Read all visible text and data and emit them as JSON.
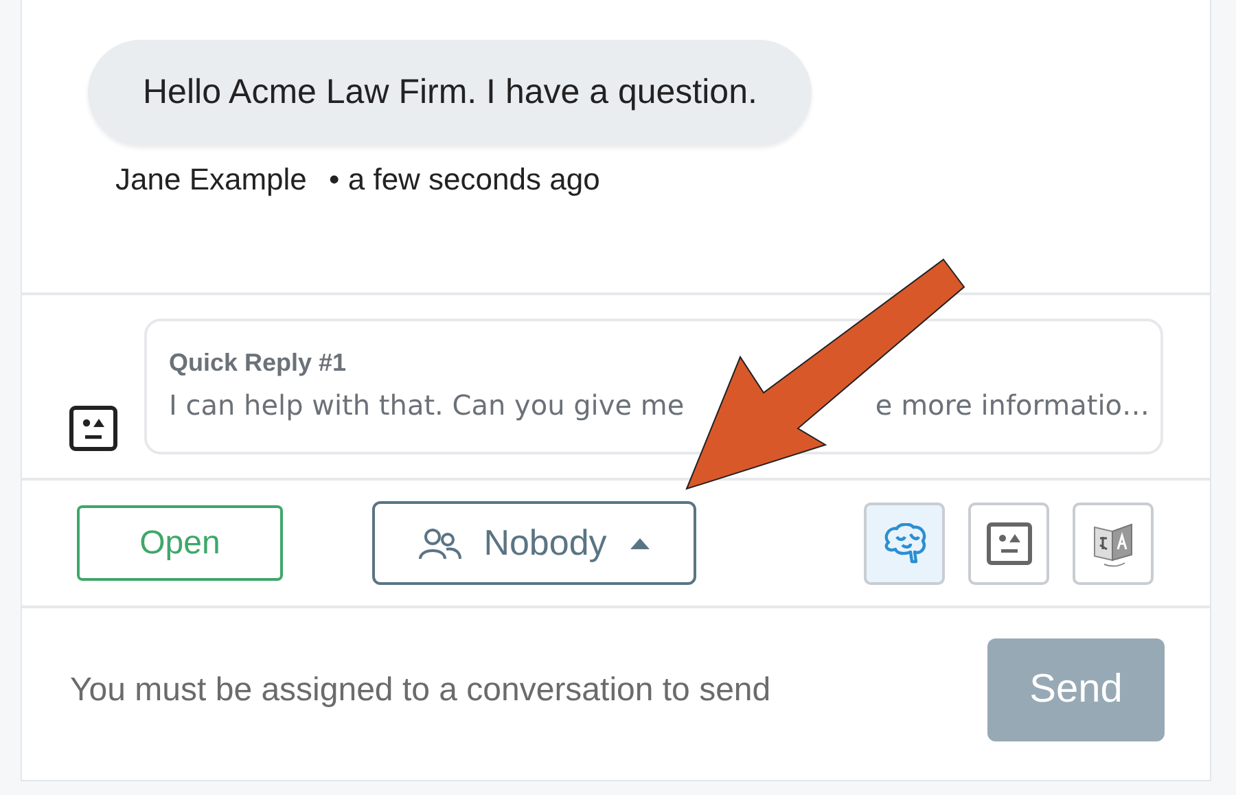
{
  "message": {
    "text": "Hello Acme Law Firm. I have a question.",
    "author": "Jane Example",
    "time": "• a few seconds ago"
  },
  "quick_reply": {
    "title": "Quick Reply #1",
    "text_parts": [
      "I can help with that. Can you give me",
      "e more informatio…"
    ]
  },
  "toolbar": {
    "status": "Open",
    "assignee": "Nobody",
    "tools": [
      {
        "kind": "brain",
        "selected": true
      },
      {
        "kind": "robot",
        "selected": false
      },
      {
        "kind": "translate",
        "selected": false
      }
    ]
  },
  "composer": {
    "placeholder": "You must be assigned to a conversation to send",
    "send": "Send",
    "disabled": true
  }
}
